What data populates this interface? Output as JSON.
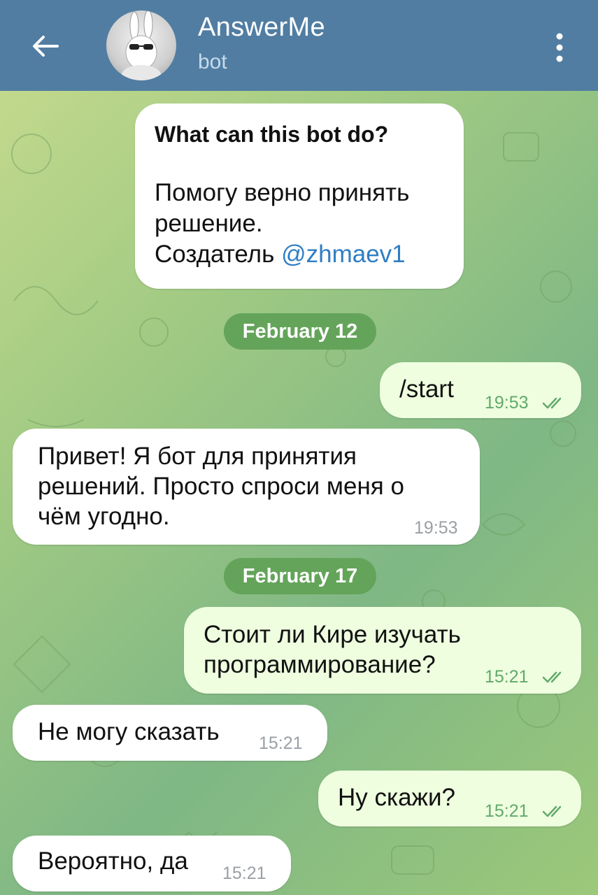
{
  "header": {
    "back_icon": "arrow-left-icon",
    "title": "AnswerMe",
    "subtitle": "bot",
    "menu_icon": "vertical-dots-icon"
  },
  "info": {
    "title": "What can this bot do?",
    "line1": "Помогу верно принять",
    "line2": "решение.",
    "creator_label": "Создатель ",
    "creator_link": "@zhmaev1"
  },
  "dates": [
    "February 12",
    "February 17"
  ],
  "messages": [
    {
      "direction": "outgoing",
      "lines": [
        "/start"
      ],
      "time": "19:53",
      "read": true
    },
    {
      "direction": "incoming",
      "lines": [
        "Привет! Я бот для принятия",
        "решений. Просто спроси меня о",
        "чём угодно."
      ],
      "time": "19:53"
    },
    {
      "direction": "outgoing",
      "lines": [
        "Стоит ли Кире изучать",
        "программирование?"
      ],
      "time": "15:21",
      "read": true
    },
    {
      "direction": "incoming",
      "lines": [
        "Не могу сказать"
      ],
      "time": "15:21"
    },
    {
      "direction": "outgoing",
      "lines": [
        "Ну скажи?"
      ],
      "time": "15:21",
      "read": true
    },
    {
      "direction": "incoming",
      "lines": [
        "Вероятно, да"
      ],
      "time": "15:21"
    }
  ],
  "colors": {
    "header": "#517da2",
    "outgoing_bubble": "#eefedf",
    "incoming_bubble": "#ffffff",
    "date_pill": "#64a45a",
    "link": "#2f7ec3"
  }
}
